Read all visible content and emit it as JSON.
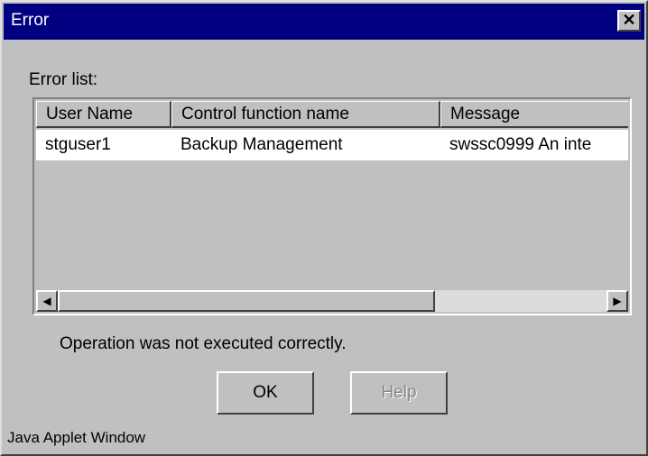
{
  "window": {
    "title": "Error"
  },
  "error_list_label": "Error list:",
  "table": {
    "columns": [
      "User Name",
      "Control function name",
      "Message"
    ],
    "rows": [
      [
        "stguser1",
        "Backup Management",
        "swssc0999 An inte"
      ]
    ]
  },
  "status_message": "Operation was not executed correctly.",
  "buttons": {
    "ok": "OK",
    "help": "Help"
  },
  "footer": "Java Applet Window",
  "icons": {
    "close": "close-icon",
    "scroll_left": "arrow-left-icon",
    "scroll_right": "arrow-right-icon"
  }
}
